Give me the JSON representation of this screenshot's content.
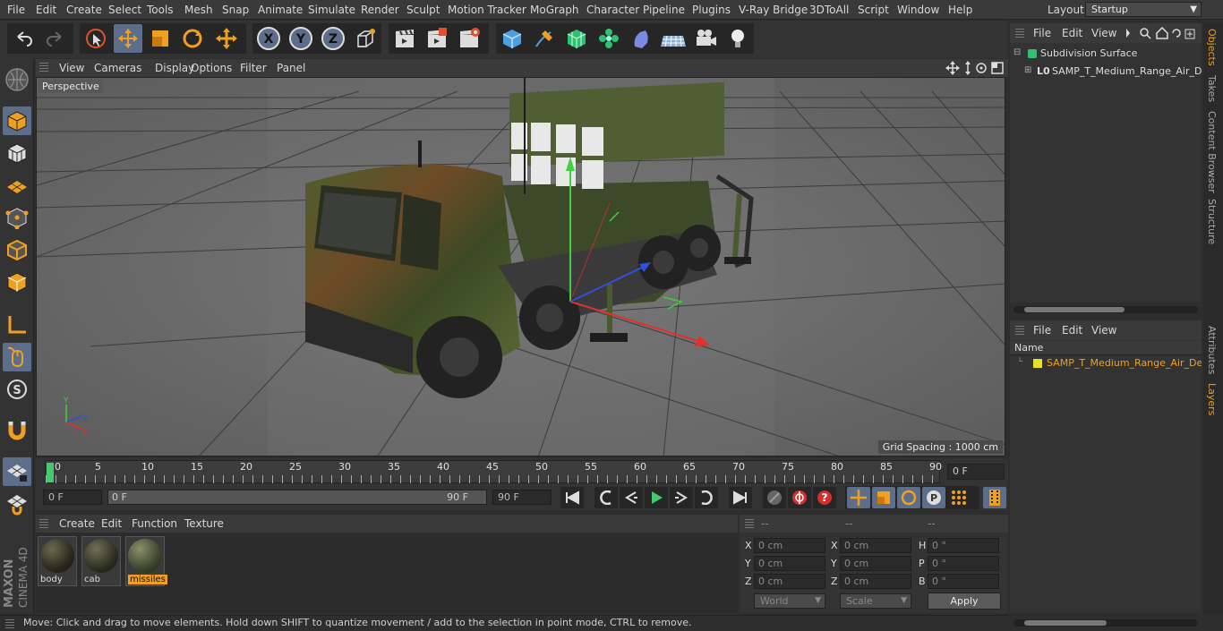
{
  "menubar": {
    "items": [
      "File",
      "Edit",
      "Create",
      "Select",
      "Tools",
      "Mesh",
      "Snap",
      "Animate",
      "Simulate",
      "Render",
      "Sculpt",
      "Motion Tracker",
      "MoGraph",
      "Character",
      "Pipeline",
      "Plugins",
      "V-Ray Bridge",
      "3DToAll",
      "Script",
      "Window",
      "Help"
    ],
    "layout_label": "Layout:",
    "layout_value": "Startup"
  },
  "viewport": {
    "menu": [
      "View",
      "Cameras",
      "Display",
      "Options",
      "Filter",
      "Panel"
    ],
    "camera_label": "Perspective",
    "grid_spacing": "Grid Spacing : 1000 cm"
  },
  "timeline": {
    "ticks": [
      "0",
      "5",
      "10",
      "15",
      "20",
      "25",
      "30",
      "35",
      "40",
      "45",
      "50",
      "55",
      "60",
      "65",
      "70",
      "75",
      "80",
      "85",
      "90"
    ],
    "current_frame": "0 F"
  },
  "transport": {
    "start_field": "0 F",
    "range_start": "0 F",
    "range_end": "90 F",
    "end_field": "90 F"
  },
  "materials": {
    "menu": [
      "Create",
      "Edit",
      "Function",
      "Texture"
    ],
    "items": [
      {
        "name": "body",
        "selected": false
      },
      {
        "name": "cab",
        "selected": false
      },
      {
        "name": "missiles",
        "selected": true
      }
    ]
  },
  "coords": {
    "headers": [
      "--",
      "--",
      "--"
    ],
    "rows": [
      {
        "l1": "X",
        "v1": "0 cm",
        "l2": "X",
        "v2": "0 cm",
        "l3": "H",
        "v3": "0 °"
      },
      {
        "l1": "Y",
        "v1": "0 cm",
        "l2": "Y",
        "v2": "0 cm",
        "l3": "P",
        "v3": "0 °"
      },
      {
        "l1": "Z",
        "v1": "0 cm",
        "l2": "Z",
        "v2": "0 cm",
        "l3": "B",
        "v3": "0 °"
      }
    ],
    "mode_select": "World",
    "scale_select": "Scale",
    "apply_label": "Apply"
  },
  "objects": {
    "menu": [
      "File",
      "Edit",
      "View"
    ],
    "items": [
      "Subdivision Surface",
      "SAMP_T_Medium_Range_Air_Def"
    ]
  },
  "layers": {
    "menu": [
      "File",
      "Edit",
      "View"
    ],
    "column_header": "Name",
    "items": [
      "SAMP_T_Medium_Range_Air_Defe"
    ]
  },
  "side_tabs": [
    "Objects",
    "Takes",
    "Content Browser",
    "Structure",
    "Attributes",
    "Layers"
  ],
  "branding": {
    "line1": "MAXON",
    "line2": "CINEMA 4D"
  },
  "status_text": "Move: Click and drag to move elements. Hold down SHIFT to quantize movement / add to the selection in point mode, CTRL to remove.",
  "colors": {
    "accent": "#f0a020",
    "toolbar_active": "#5c6e8a",
    "playhead": "#46c86e"
  }
}
